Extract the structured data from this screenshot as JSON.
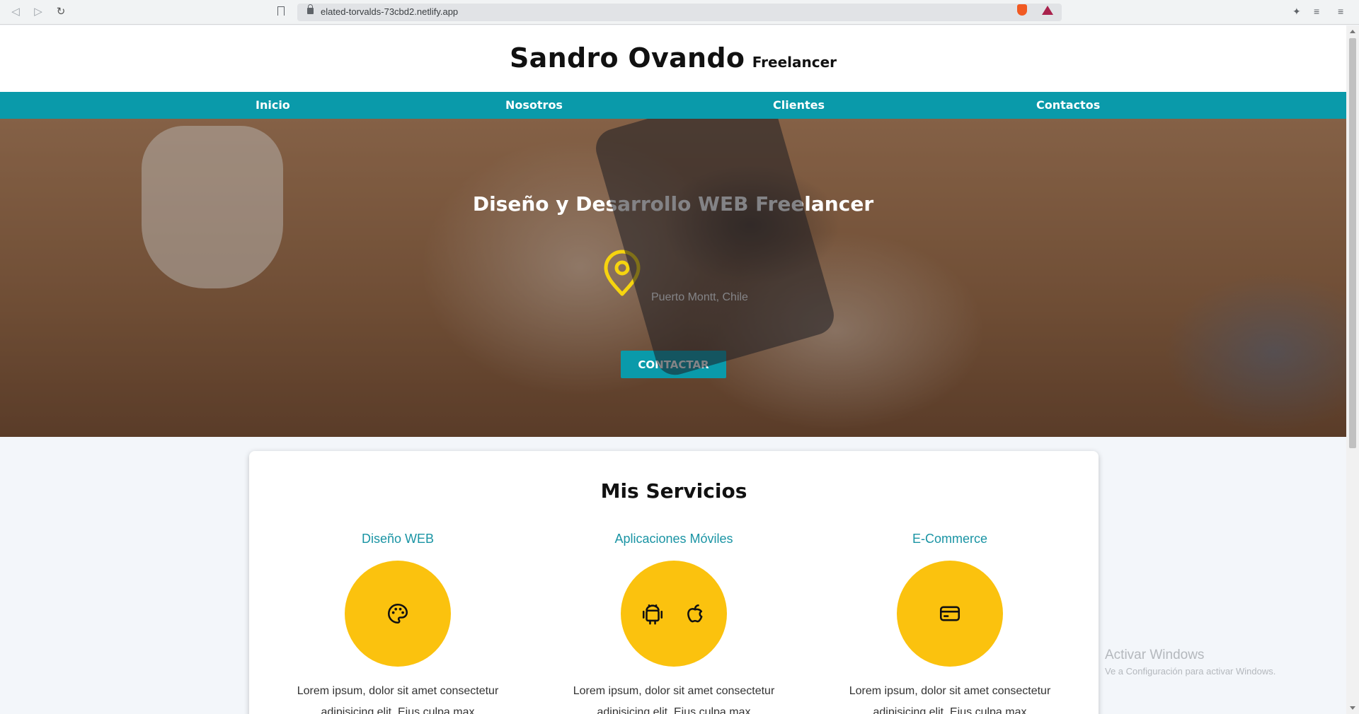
{
  "browser": {
    "url": "elated-torvalds-73cbd2.netlify.app"
  },
  "header": {
    "name": "Sandro Ovando",
    "role": "Freelancer"
  },
  "nav": {
    "items": [
      {
        "label": "Inicio"
      },
      {
        "label": "Nosotros"
      },
      {
        "label": "Clientes"
      },
      {
        "label": "Contactos"
      }
    ]
  },
  "hero": {
    "title": "Diseño y Desarrollo WEB Freelancer",
    "location": "Puerto Montt, Chile",
    "cta_label": "CONTACTAR",
    "icon": "location-pin-icon"
  },
  "services": {
    "title": "Mis Servicios",
    "items": [
      {
        "name": "Diseño WEB",
        "text": "Lorem ipsum, dolor sit amet consectetur adipisicing elit. Eius culpa max",
        "icons": [
          "palette-icon"
        ]
      },
      {
        "name": "Aplicaciones Móviles",
        "text": "Lorem ipsum, dolor sit amet consectetur adipisicing elit. Eius culpa max",
        "icons": [
          "android-icon",
          "apple-icon"
        ]
      },
      {
        "name": "E-Commerce",
        "text": "Lorem ipsum, dolor sit amet consectetur adipisicing elit. Eius culpa max",
        "icons": [
          "credit-card-icon"
        ]
      }
    ]
  },
  "watermark": {
    "title": "Activar Windows",
    "subtitle": "Ve a Configuración para activar Windows."
  },
  "colors": {
    "accent": "#0a9aaa",
    "highlight": "#fbc20e",
    "service_title": "#1a94a4"
  }
}
